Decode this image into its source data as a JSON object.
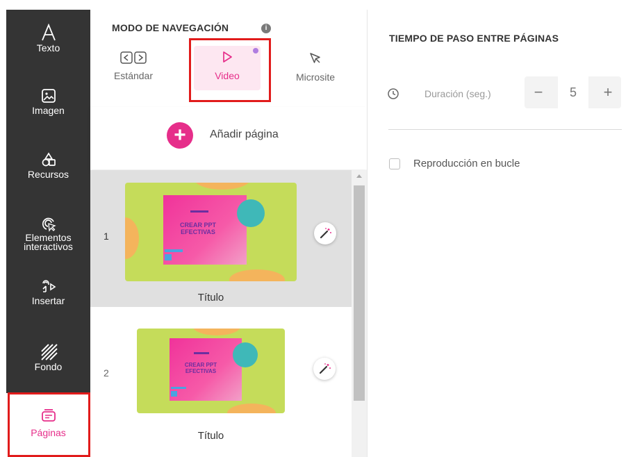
{
  "sidebar": {
    "items": [
      {
        "label": "Texto",
        "icon": "text-icon"
      },
      {
        "label": "Imagen",
        "icon": "image-icon"
      },
      {
        "label": "Recursos",
        "icon": "resources-icon"
      },
      {
        "label": "Elementos interactivos",
        "icon": "interactive-icon"
      },
      {
        "label": "Insertar",
        "icon": "insert-icon"
      },
      {
        "label": "Fondo",
        "icon": "background-icon"
      },
      {
        "label": "Páginas",
        "icon": "pages-icon",
        "active": true
      }
    ]
  },
  "navigation": {
    "title": "MODO DE NAVEGACIÓN",
    "modes": [
      {
        "label": "Estándar",
        "icon": "standard-mode-icon"
      },
      {
        "label": "Video",
        "icon": "play-icon",
        "selected": true
      },
      {
        "label": "Microsite",
        "icon": "cursor-icon"
      }
    ]
  },
  "pages": {
    "add_label": "Añadir página",
    "items": [
      {
        "number": "1",
        "title": "Título",
        "thumb_text": "CREAR PPT EFECTIVAS",
        "selected": true
      },
      {
        "number": "2",
        "title": "Título",
        "thumb_text": "CREAR PPT EFECTIVAS",
        "selected": false
      }
    ]
  },
  "timing": {
    "title": "TIEMPO DE PASO ENTRE PÁGINAS",
    "duration_label": "Duración (seg.)",
    "duration_value": "5",
    "minus": "−",
    "plus": "+",
    "loop_label": "Reproducción en bucle",
    "loop_checked": false
  },
  "colors": {
    "accent": "#e62e8a",
    "sidebar_bg": "#343434",
    "highlight": "#e11b1b"
  }
}
